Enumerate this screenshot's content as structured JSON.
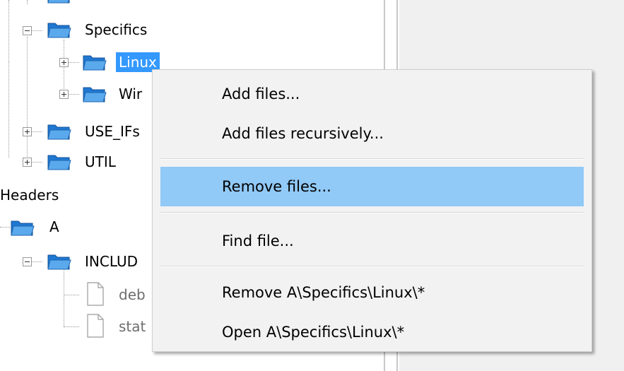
{
  "tree": {
    "nodes": {
      "specifics": "Specifics",
      "linux": "Linux",
      "windows_partial": "Wir",
      "use_ifs_partial": "USE_IFs",
      "util": "UTIL",
      "headers": "Headers",
      "a": "A",
      "includes_partial": "INCLUD",
      "deb_partial": "deb",
      "stat_partial": "stat"
    }
  },
  "context_menu": {
    "items": [
      "Add files...",
      "Add files recursively...",
      "Remove files...",
      "Find file...",
      "Remove A\\Specifics\\Linux\\*",
      "Open A\\Specifics\\Linux\\*"
    ],
    "highlighted_index": 2
  },
  "icons": {
    "folder": "open-folder-icon",
    "file": "document-icon",
    "expand": "plus-box-icon",
    "collapse": "minus-box-icon"
  },
  "colors": {
    "selection": "#3399ff",
    "menu_highlight": "#91c9f7",
    "menu_background": "#f2f2f2",
    "folder_blue": "#2e83d6"
  }
}
